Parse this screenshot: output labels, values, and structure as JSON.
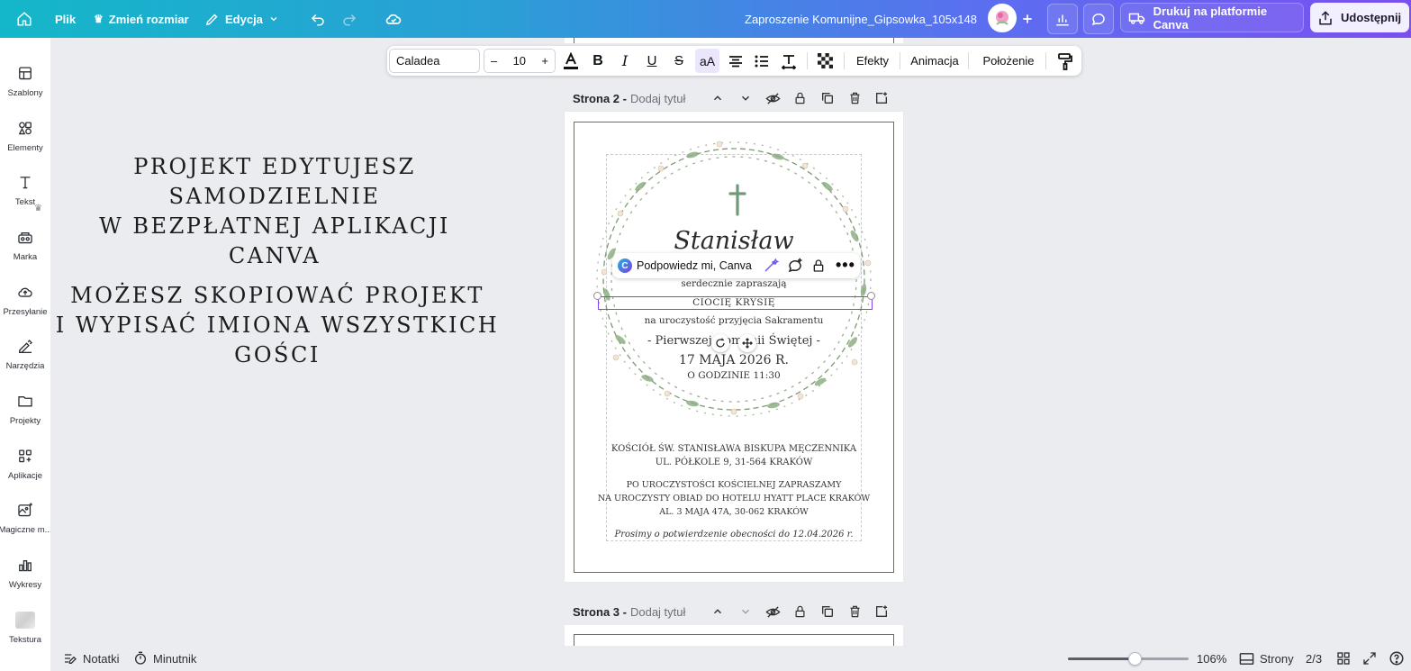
{
  "topbar": {
    "home_icon": "home-icon",
    "file_label": "Plik",
    "resize_label": "Zmień rozmiar",
    "edit_label": "Edycja",
    "doc_title": "Zaproszenie Komunijne_Gipsowka_105x148",
    "print_label": "Drukuj na platformie Canva",
    "share_label": "Udostępnij",
    "gradient_start": "#14b7c9",
    "gradient_end": "#7a4ff0"
  },
  "sidebar": {
    "items": [
      {
        "label": "Szablony",
        "icon": "templates-icon"
      },
      {
        "label": "Elementy",
        "icon": "elements-icon"
      },
      {
        "label": "Tekst",
        "icon": "text-icon"
      },
      {
        "label": "Marka",
        "icon": "brand-icon"
      },
      {
        "label": "Przesyłanie",
        "icon": "upload-icon"
      },
      {
        "label": "Narzędzia",
        "icon": "draw-icon"
      },
      {
        "label": "Projekty",
        "icon": "folder-icon"
      },
      {
        "label": "Aplikacje",
        "icon": "apps-icon"
      },
      {
        "label": "Magiczne m...",
        "icon": "magic-media-icon"
      },
      {
        "label": "Wykresy",
        "icon": "charts-icon"
      },
      {
        "label": "Tekstura",
        "icon": "texture-icon"
      }
    ]
  },
  "canvas": {
    "left_text_1_line1": "PROJEKT EDYTUJESZ SAMODZIELNIE",
    "left_text_1_line2": "W BEZPŁATNEJ APLIKACJI CANVA",
    "left_text_2_line1": "MOŻESZ SKOPIOWAĆ PROJEKT",
    "left_text_2_line2": "I WYPISAĆ IMIONA WSZYSTKICH GOŚCI"
  },
  "format_toolbar": {
    "font": "Caladea",
    "size": "10",
    "minus": "–",
    "plus": "+",
    "case_label": "aA",
    "effects_label": "Efekty",
    "animation_label": "Animacja",
    "position_label": "Położenie"
  },
  "page2": {
    "title": "Strona 2 -",
    "subtitle": "Dodaj tytuł"
  },
  "page3": {
    "title": "Strona 3 -",
    "subtitle": "Dodaj tytuł"
  },
  "invitation": {
    "name_script": "Stanisław",
    "line_invite": "serdecznie zapraszają",
    "line_guest": "CIOCIĘ KRYSIĘ",
    "line_occasion": "na uroczystość przyjęcia Sakramentu",
    "line_communion": "- Pierwszej Komunii Świętej -",
    "line_date": "17 MAJA 2026 R.",
    "line_time": "O GODZINIE 11:30",
    "church_1": "KOŚCIÓŁ ŚW. STANISŁAWA BISKUPA MĘCZENNIKA",
    "church_2": "UL. PÓŁKOLE 9, 31-564 KRAKÓW",
    "dinner_1": "PO UROCZYSTOŚCI KOŚCIELNEJ ZAPRASZAMY",
    "dinner_2": "NA UROCZYSTY OBIAD DO HOTELU HYATT PLACE KRAKÓW",
    "dinner_3": "AL. 3 MAJA 47A, 30-062 KRAKÓW",
    "rsvp": "Prosimy o potwierdzenie obecności do 12.04.2026 r."
  },
  "ai_pill": {
    "label": "Podpowiedz mi, Canva"
  },
  "bottombar": {
    "notes_label": "Notatki",
    "timer_label": "Minutnik",
    "zoom_label": "106%",
    "zoom_fraction": 0.55,
    "pages_label": "Strony",
    "page_count": "2/3"
  },
  "colors": {
    "accent": "#8b3dff",
    "selection": "#8b3dff",
    "wreath_green": "#7d9a72",
    "cross_green": "#6e9a7a"
  }
}
